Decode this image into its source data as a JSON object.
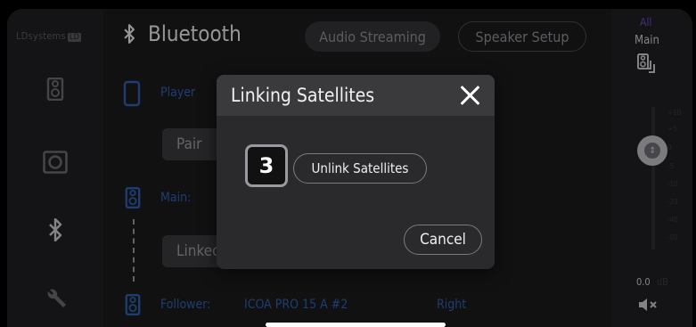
{
  "brand": {
    "name": "LDsystems",
    "logo_text": "LD"
  },
  "header": {
    "title": "Bluetooth",
    "tab_audio": "Audio Streaming",
    "tab_speaker": "Speaker Setup"
  },
  "background": {
    "player_label": "Player",
    "pair_button": "Pair",
    "main_label": "Main:",
    "linked_button": "Linked",
    "follower_label": "Follower:",
    "follower_device": "ICOA PRO 15 A #2",
    "follower_side": "Right"
  },
  "right_panel": {
    "group_label": "All",
    "channel_label": "Main",
    "scale_ticks": [
      "+10",
      "+5",
      "0",
      "-5",
      "-10",
      "-20",
      "-40",
      "-80"
    ],
    "level_value": "0.0",
    "level_unit": "dB"
  },
  "dialog": {
    "title": "Linking Satellites",
    "step_number": "3",
    "unlink_button": "Unlink Satellites",
    "cancel_button": "Cancel"
  },
  "colors": {
    "accent_blue": "#2f5fb0",
    "dialog_bg": "#2a2a2c",
    "dialog_header": "#3a3a3c"
  }
}
